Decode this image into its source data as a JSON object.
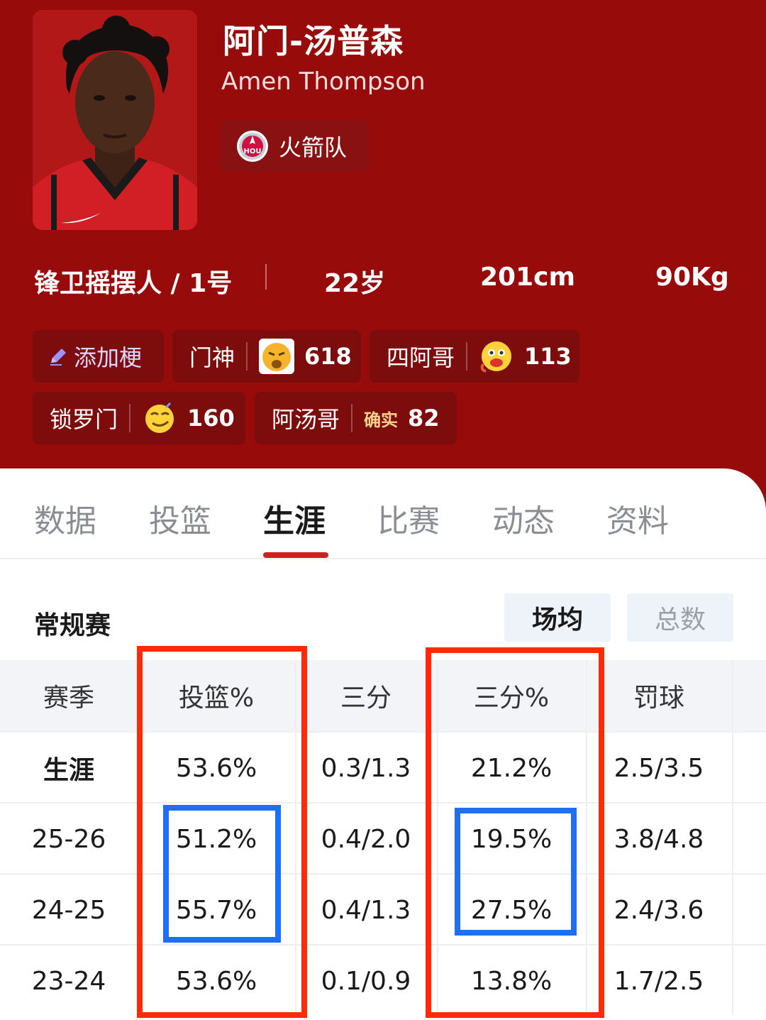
{
  "player": {
    "name_cn": "阿门-汤普森",
    "name_en": "Amen Thompson",
    "team": "火箭队",
    "team_logo_text": "HOU",
    "position": "锋卫摇摆人 / 1号",
    "age": "22岁",
    "height": "201cm",
    "weight": "90Kg"
  },
  "nicknames": {
    "add_label": "添加梗",
    "items": [
      {
        "label": "门神",
        "count": "618",
        "emoji": "grumpy-face-icon"
      },
      {
        "label": "四阿哥",
        "count": "113",
        "emoji": "drooling-face-icon"
      },
      {
        "label": "锁罗门",
        "count": "160",
        "emoji": "smirk-face-icon"
      },
      {
        "label": "阿汤哥",
        "count": "82",
        "tag": "确实"
      }
    ]
  },
  "tabs": [
    {
      "label": "数据",
      "active": false
    },
    {
      "label": "投篮",
      "active": false
    },
    {
      "label": "生涯",
      "active": true
    },
    {
      "label": "比赛",
      "active": false
    },
    {
      "label": "动态",
      "active": false
    },
    {
      "label": "资料",
      "active": false
    }
  ],
  "section": {
    "title": "常规赛",
    "toggle_on": "场均",
    "toggle_off": "总数"
  },
  "table": {
    "headers": [
      "赛季",
      "投篮%",
      "三分",
      "三分%",
      "罚球"
    ],
    "rows": [
      [
        "生涯",
        "53.6%",
        "0.3/1.3",
        "21.2%",
        "2.5/3.5"
      ],
      [
        "25-26",
        "51.2%",
        "0.4/2.0",
        "19.5%",
        "3.8/4.8"
      ],
      [
        "24-25",
        "55.7%",
        "0.4/1.3",
        "27.5%",
        "2.4/3.6"
      ],
      [
        "23-24",
        "53.6%",
        "0.1/0.9",
        "13.8%",
        "1.7/2.5"
      ]
    ]
  },
  "colors": {
    "header_bg": "#970b0b",
    "chip_bg": "#7d0c0c",
    "tab_accent": "#d31f1f",
    "highlight_red": "#ff2a0a",
    "highlight_blue": "#1f6ff2"
  }
}
